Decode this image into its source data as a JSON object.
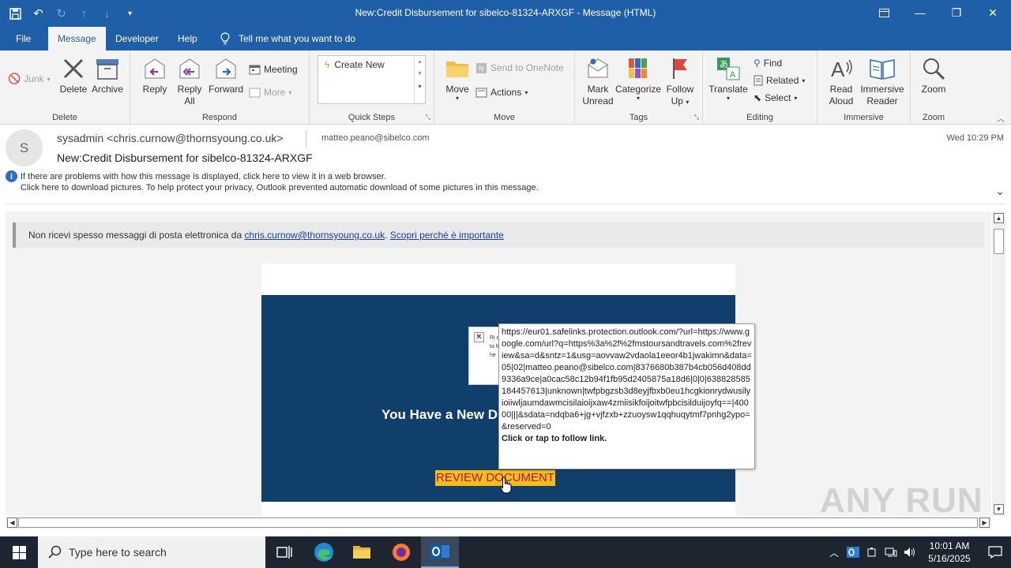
{
  "window": {
    "title": "New:Credit Disbursement for sibelco-81324-ARXGF  -  Message (HTML)"
  },
  "menu": {
    "tabs": [
      "File",
      "Message",
      "Developer",
      "Help"
    ],
    "tell_me": "Tell me what you want to do"
  },
  "ribbon": {
    "delete_group": {
      "label": "Delete",
      "junk": "Junk",
      "delete": "Delete",
      "archive": "Archive"
    },
    "respond_group": {
      "label": "Respond",
      "reply": "Reply",
      "reply_all_1": "Reply",
      "reply_all_2": "All",
      "forward": "Forward",
      "meeting": "Meeting",
      "more": "More"
    },
    "quicksteps_group": {
      "label": "Quick Steps",
      "create_new": "Create New"
    },
    "move_group": {
      "label": "Move",
      "move": "Move",
      "send_onenote": "Send to OneNote",
      "actions": "Actions"
    },
    "tags_group": {
      "label": "Tags",
      "mark_unread_1": "Mark",
      "mark_unread_2": "Unread",
      "categorize": "Categorize",
      "follow_up_1": "Follow",
      "follow_up_2": "Up"
    },
    "editing_group": {
      "label": "Editing",
      "translate": "Translate",
      "find": "Find",
      "related": "Related",
      "select": "Select"
    },
    "immersive_group": {
      "label": "Immersive",
      "read_aloud_1": "Read",
      "read_aloud_2": "Aloud",
      "immersive_reader_1": "Immersive",
      "immersive_reader_2": "Reader"
    },
    "zoom_group": {
      "label": "Zoom",
      "zoom": "Zoom"
    }
  },
  "message": {
    "avatar_initial": "S",
    "from": "sysadmin <chris.curnow@thornsyoung.co.uk>",
    "to": "matteo.peano@sibelco.com",
    "date": "Wed 10:29 PM",
    "subject": "New:Credit Disbursement for sibelco-81324-ARXGF",
    "info_line1": "If there are problems with how this message is displayed, click here to view it in a web browser.",
    "info_line2": "Click here to download pictures. To help protect your privacy, Outlook prevented automatic download of some pictures in this message."
  },
  "body": {
    "notice_prefix": "Non ricevi spesso messaggi di posta elettronica da ",
    "notice_link": "chris.curnow@thornsyoung.co.uk",
    "notice_sep": ". ",
    "notice_link2": "Scopri perché è importante",
    "headline": "You Have a New D",
    "button": "REVIEW DOCUMENT",
    "broken_image_text": "Ri cli ta ho he"
  },
  "tooltip": {
    "url": "https://eur01.safelinks.protection.outlook.com/?url=https://www.google.com/url?q=https%3a%2f%2fmstoursandtravels.com%2freview&sa=d&sntz=1&usg=aovvaw2vdaola1eeor4b1jwakimn&data=05|02|matteo.peano@sibelco.com|8376680b387b4cb056d408dd9336a9ce|a0cac58c12b94f1fb95d2405875a18d6|0|0|638828585184457613|unknown|twfpbgzsb3d8eyjfbxb0eu1hcgkionrydwusilyioiiwljaumdawmcisilaioijxaw4zmiisikfoijoitwfpbcisilduijoyfq==|40000|||&sdata=ndqba6+jg+vjfzxb+zzuoysw1qqhuqytmf7pnhg2ypo=&reserved=0",
    "follow": "Click or tap to follow link."
  },
  "watermark": "ANY RUN",
  "taskbar": {
    "search_placeholder": "Type here to search",
    "time": "10:01 AM",
    "date": "5/16/2025"
  }
}
